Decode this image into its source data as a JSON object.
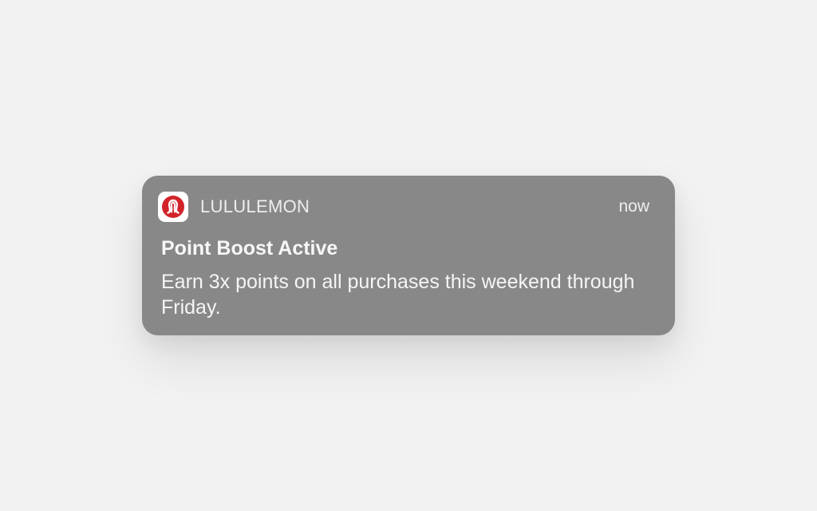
{
  "notification": {
    "app_name": "LULULEMON",
    "app_icon": "lululemon-logo-icon",
    "time": "now",
    "title": "Point Boost Active",
    "body": "Earn 3x points on all purchases this weekend through Friday."
  },
  "colors": {
    "background": "#f2f2f2",
    "card": "#888888",
    "brand": "#d2232a",
    "text": "#f5f5f5"
  }
}
